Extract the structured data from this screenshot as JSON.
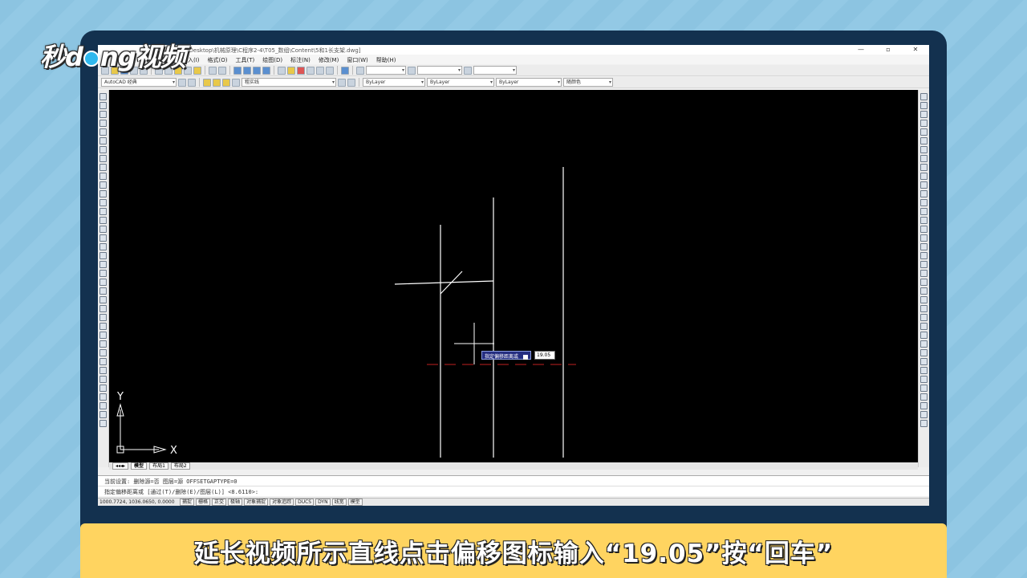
{
  "brand": {
    "logo_text_a": "秒d",
    "logo_text_b": "ng视频"
  },
  "window": {
    "path": "er\\Desktop\\机械原理\\C程序2-4\\T05_数组\\Content\\5和1长支架.dwg]",
    "controls": [
      "—",
      "▫",
      "✕"
    ]
  },
  "menu": [
    "插入(I)",
    "格式(O)",
    "工具(T)",
    "绘图(D)",
    "标注(N)",
    "修改(M)",
    "窗口(W)",
    "帮助(H)"
  ],
  "toolbar": {
    "workspace": "AutoCAD 经典",
    "layer": "粗实线",
    "color": "ByLayer",
    "linetype": "ByLayer",
    "lineweight": "ByLayer",
    "plotstyle": "随颜色"
  },
  "layout_tabs": [
    "模型",
    "布局1",
    "布局2"
  ],
  "command": {
    "line1": "当前设置: 删除源=否  图层=源  OFFSETGAPTYPE=0",
    "line2": "指定偏移距离或 [通过(T)/删除(E)/图层(L)] <8.6110>:"
  },
  "status": {
    "coords": "1000.7724, 1036.0650, 0.0000",
    "buttons": [
      "捕捉",
      "栅格",
      "正交",
      "极轴",
      "对象捕捉",
      "对象追踪",
      "DUCS",
      "DYN",
      "线宽",
      "模型"
    ]
  },
  "dynamic_input": {
    "prompt": "指定偏移距离或",
    "value": "19.05"
  },
  "ucs": {
    "x": "X",
    "y": "Y"
  },
  "caption": "延长视频所示直线点击偏移图标输入“19.05”按“回车”"
}
